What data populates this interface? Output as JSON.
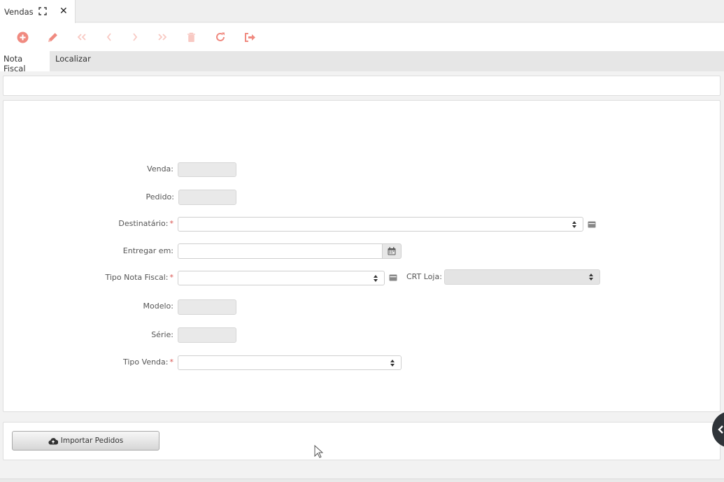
{
  "window_tab": {
    "title": "Vendas",
    "maximize_icon": "maximize-icon",
    "close_icon": "close-icon",
    "close_glyph": "✕"
  },
  "toolbar": {
    "icon_color": "#f08a80",
    "icon_color_disabled": "#f8c9c3",
    "buttons": [
      {
        "name": "add-button",
        "icon": "plus-circle-icon",
        "enabled": true
      },
      {
        "name": "edit-button",
        "icon": "pencil-icon",
        "enabled": true
      },
      {
        "name": "first-record-button",
        "icon": "double-chevron-left-icon",
        "enabled": false
      },
      {
        "name": "previous-record-button",
        "icon": "chevron-left-icon",
        "enabled": false
      },
      {
        "name": "next-record-button",
        "icon": "chevron-right-icon",
        "enabled": false
      },
      {
        "name": "last-record-button",
        "icon": "double-chevron-right-icon",
        "enabled": false
      },
      {
        "name": "delete-button",
        "icon": "trash-icon",
        "enabled": false
      },
      {
        "name": "refresh-button",
        "icon": "refresh-icon",
        "enabled": true
      },
      {
        "name": "exit-button",
        "icon": "sign-out-icon",
        "enabled": true
      }
    ]
  },
  "tabs": [
    {
      "label": "Nota Fiscal",
      "active": true
    },
    {
      "label": "Localizar",
      "active": false
    }
  ],
  "form": {
    "venda": {
      "label": "Venda:",
      "value": ""
    },
    "pedido": {
      "label": "Pedido:",
      "value": ""
    },
    "destinatario": {
      "label": "Destinatário:",
      "required": "*",
      "value": ""
    },
    "entregar_em": {
      "label": "Entregar em:",
      "value": "",
      "icon": "calendar-icon"
    },
    "tipo_nota_fiscal": {
      "label": "Tipo Nota Fiscal:",
      "required": "*",
      "value": ""
    },
    "crt_loja": {
      "label": "CRT Loja:",
      "value": ""
    },
    "modelo": {
      "label": "Modelo:",
      "value": ""
    },
    "serie": {
      "label": "Série:",
      "value": ""
    },
    "tipo_venda": {
      "label": "Tipo Venda:",
      "required": "*",
      "value": ""
    }
  },
  "footer": {
    "import_button": "Importar Pedidos",
    "import_icon": "cloud-upload-icon"
  },
  "side_toggle_icon": "chevron-left-icon",
  "colors": {
    "required": "#d9534f",
    "readonly_bg": "#e9e9e9",
    "side_toggle": "#2f3439"
  }
}
